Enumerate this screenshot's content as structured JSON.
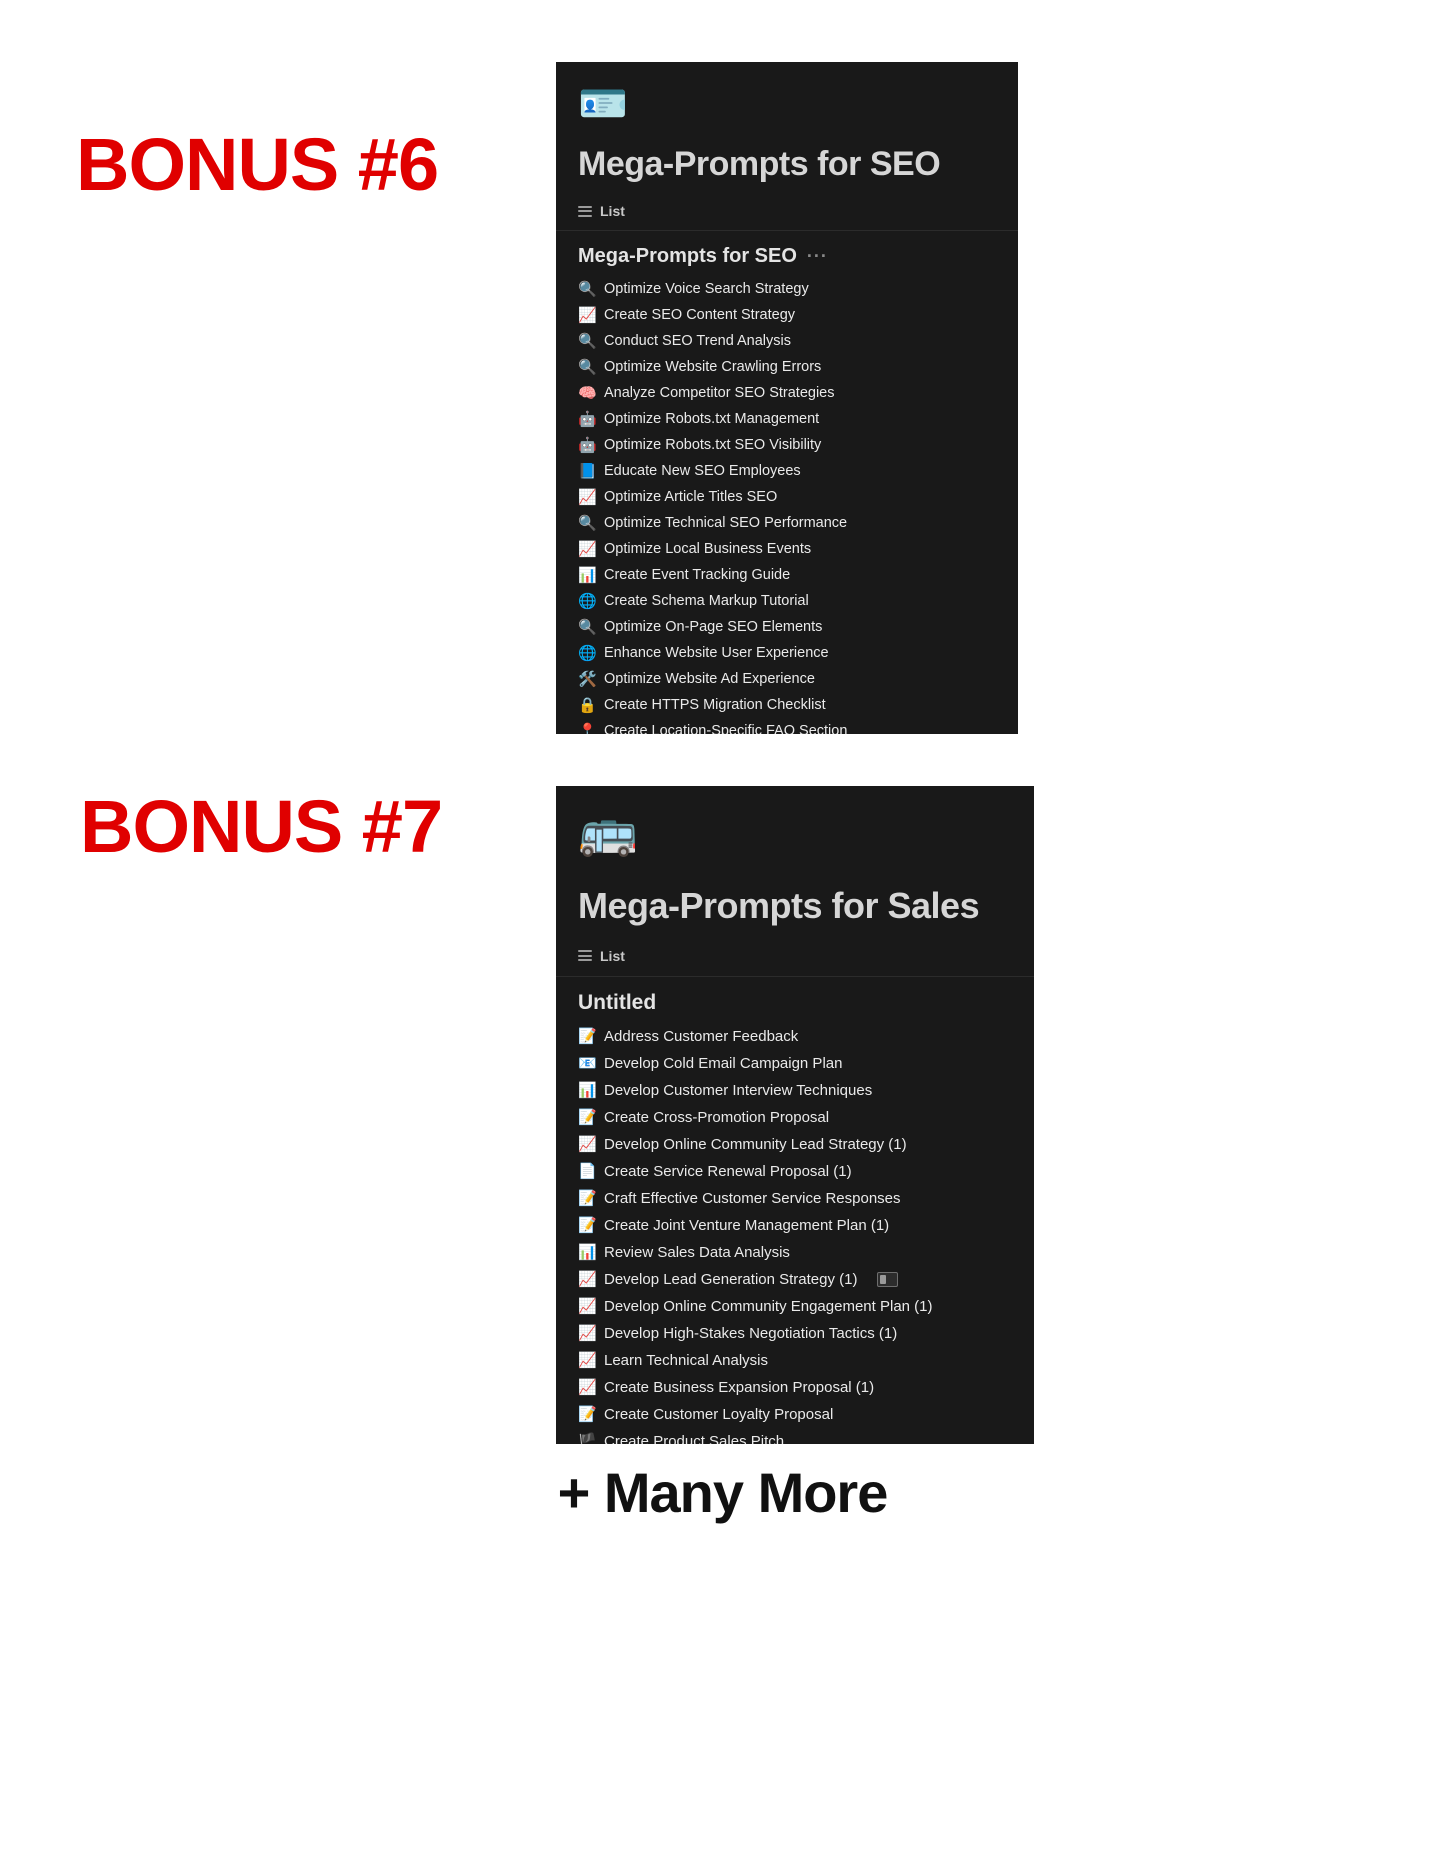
{
  "bonus_labels": {
    "six": "BONUS #6",
    "seven": "BONUS #7"
  },
  "footer": {
    "many_more": "+ Many More"
  },
  "colors": {
    "accent_red": "#e00000",
    "card_background": "#191919",
    "page_background": "#ffffff",
    "title_text": "#d6d6d6",
    "row_text": "#eaeaea"
  },
  "seo_card": {
    "page_emoji": "🪪",
    "page_emoji_name": "identification-card-emoji",
    "title": "Mega-Prompts for SEO",
    "view": {
      "icon": "list-icon",
      "label": "List"
    },
    "group": {
      "heading": "Mega-Prompts for SEO",
      "more_menu": "···"
    },
    "items": [
      {
        "emoji": "🔍",
        "emoji_name": "magnifying-glass-emoji",
        "title": "Optimize Voice Search Strategy"
      },
      {
        "emoji": "📈",
        "emoji_name": "chart-increasing-emoji",
        "title": "Create SEO Content Strategy"
      },
      {
        "emoji": "🔍",
        "emoji_name": "magnifying-glass-emoji",
        "title": "Conduct SEO Trend Analysis"
      },
      {
        "emoji": "🔍",
        "emoji_name": "magnifying-glass-emoji",
        "title": "Optimize Website Crawling Errors"
      },
      {
        "emoji": "🧠",
        "emoji_name": "brain-emoji",
        "title": "Analyze Competitor SEO Strategies"
      },
      {
        "emoji": "🤖",
        "emoji_name": "robot-emoji",
        "title": "Optimize Robots.txt Management"
      },
      {
        "emoji": "🤖",
        "emoji_name": "robot-emoji",
        "title": "Optimize Robots.txt SEO Visibility"
      },
      {
        "emoji": "📘",
        "emoji_name": "blue-book-emoji",
        "title": "Educate New SEO Employees"
      },
      {
        "emoji": "📈",
        "emoji_name": "chart-increasing-emoji",
        "title": "Optimize Article Titles SEO"
      },
      {
        "emoji": "🔍",
        "emoji_name": "magnifying-glass-emoji",
        "title": "Optimize Technical SEO Performance"
      },
      {
        "emoji": "📈",
        "emoji_name": "chart-increasing-emoji",
        "title": "Optimize Local Business Events"
      },
      {
        "emoji": "📊",
        "emoji_name": "bar-chart-emoji",
        "title": "Create Event Tracking Guide"
      },
      {
        "emoji": "🌐",
        "emoji_name": "globe-emoji",
        "title": "Create Schema Markup Tutorial"
      },
      {
        "emoji": "🔍",
        "emoji_name": "magnifying-glass-emoji",
        "title": "Optimize On-Page SEO Elements"
      },
      {
        "emoji": "🌐",
        "emoji_name": "globe-emoji",
        "title": "Enhance Website User Experience"
      },
      {
        "emoji": "🛠️",
        "emoji_name": "hammer-and-wrench-emoji",
        "title": "Optimize Website Ad Experience"
      },
      {
        "emoji": "🔒",
        "emoji_name": "lock-emoji",
        "title": "Create HTTPS Migration Checklist"
      },
      {
        "emoji": "📍",
        "emoji_name": "round-pushpin-emoji",
        "title": "Create Location-Specific FAQ Section"
      }
    ]
  },
  "sales_card": {
    "page_emoji": "🚌",
    "page_emoji_name": "bus-emoji",
    "title": "Mega-Prompts for Sales",
    "view": {
      "icon": "list-icon",
      "label": "List"
    },
    "group": {
      "heading": "Untitled"
    },
    "items": [
      {
        "emoji": "📝",
        "emoji_name": "memo-emoji",
        "title": "Address Customer Feedback"
      },
      {
        "emoji": "📧",
        "emoji_name": "email-emoji",
        "title": "Develop Cold Email Campaign Plan"
      },
      {
        "emoji": "📊",
        "emoji_name": "bar-chart-emoji",
        "title": "Develop Customer Interview Techniques"
      },
      {
        "emoji": "📝",
        "emoji_name": "memo-emoji",
        "title": "Create Cross-Promotion Proposal"
      },
      {
        "emoji": "📈",
        "emoji_name": "chart-increasing-emoji",
        "title": "Develop Online Community Lead Strategy (1)"
      },
      {
        "emoji": "📄",
        "emoji_name": "page-facing-up-emoji",
        "title": "Create Service Renewal Proposal (1)"
      },
      {
        "emoji": "📝",
        "emoji_name": "memo-emoji",
        "title": "Craft Effective Customer Service Responses"
      },
      {
        "emoji": "📝",
        "emoji_name": "memo-emoji",
        "title": "Create Joint Venture Management Plan (1)"
      },
      {
        "emoji": "📊",
        "emoji_name": "bar-chart-emoji",
        "title": "Review Sales Data Analysis"
      },
      {
        "emoji": "📈",
        "emoji_name": "chart-increasing-emoji",
        "title": "Develop Lead Generation Strategy (1)",
        "badge": true
      },
      {
        "emoji": "📈",
        "emoji_name": "chart-increasing-emoji",
        "title": "Develop Online Community Engagement Plan (1)"
      },
      {
        "emoji": "📈",
        "emoji_name": "chart-increasing-emoji",
        "title": "Develop High-Stakes Negotiation Tactics (1)"
      },
      {
        "emoji": "📈",
        "emoji_name": "chart-increasing-emoji",
        "title": "Learn Technical Analysis"
      },
      {
        "emoji": "📈",
        "emoji_name": "chart-increasing-emoji",
        "title": "Create Business Expansion Proposal (1)"
      },
      {
        "emoji": "📝",
        "emoji_name": "memo-emoji",
        "title": "Create Customer Loyalty Proposal"
      },
      {
        "emoji": "🏴",
        "emoji_name": "flag-emoji",
        "title": "Create Product Sales Pitch"
      }
    ]
  }
}
